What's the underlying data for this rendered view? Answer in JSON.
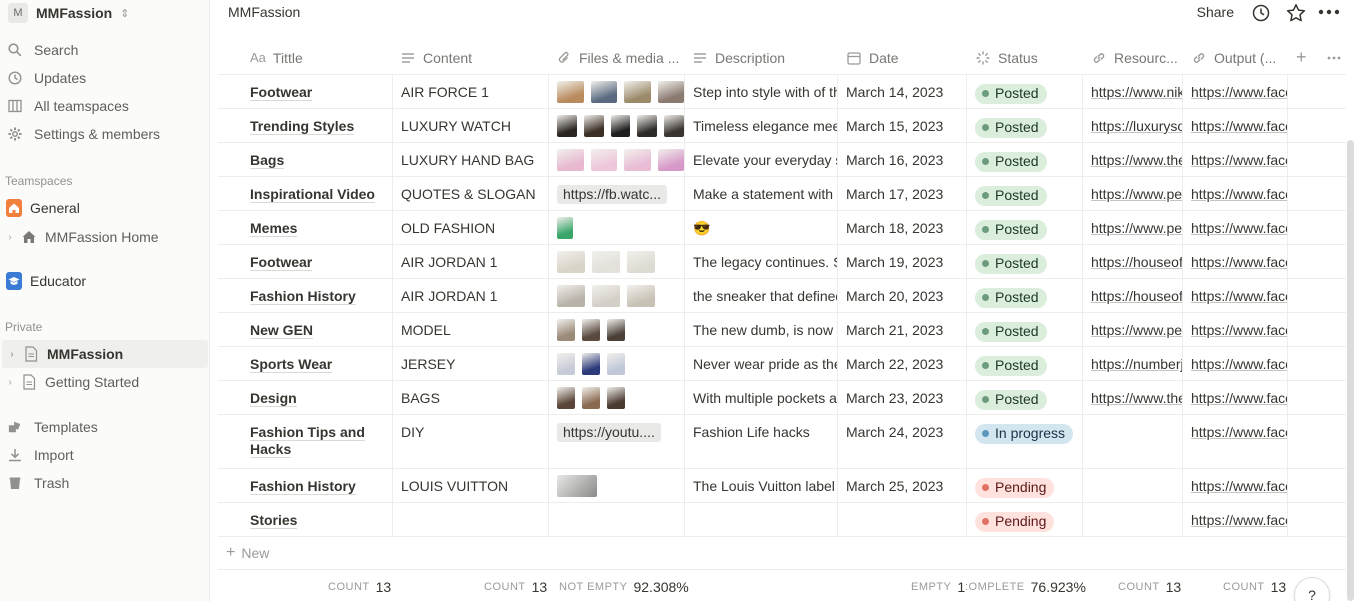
{
  "workspace": {
    "initial": "M",
    "name": "MMFassion"
  },
  "sidebar": {
    "nav": [
      {
        "label": "Search",
        "icon": "search-icon"
      },
      {
        "label": "Updates",
        "icon": "clock-icon"
      },
      {
        "label": "All teamspaces",
        "icon": "teamspaces-icon"
      },
      {
        "label": "Settings & members",
        "icon": "gear-icon"
      }
    ],
    "teamspaces_label": "Teamspaces",
    "teamspaces": [
      {
        "label": "General"
      },
      {
        "label": "MMFassion Home"
      },
      {
        "label": "Educator"
      }
    ],
    "private_label": "Private",
    "private": [
      {
        "label": "MMFassion"
      },
      {
        "label": "Getting Started"
      }
    ],
    "bottom": [
      {
        "label": "Templates",
        "icon": "templates-icon"
      },
      {
        "label": "Import",
        "icon": "import-icon"
      },
      {
        "label": "Trash",
        "icon": "trash-icon"
      }
    ]
  },
  "topbar": {
    "breadcrumb": "MMFassion",
    "share": "Share"
  },
  "table": {
    "columns": [
      {
        "label": "Tittle",
        "icon": "Aa"
      },
      {
        "label": "Content"
      },
      {
        "label": "Files & media ..."
      },
      {
        "label": "Description"
      },
      {
        "label": "Date"
      },
      {
        "label": "Status"
      },
      {
        "label": "Resourc..."
      },
      {
        "label": "Output (..."
      }
    ],
    "rows": [
      {
        "title": "Footwear",
        "content": "AIR FORCE 1",
        "files": [
          "#b98a5c",
          "#5a6a80",
          "#9a8a6a",
          "#8a7a70"
        ],
        "desc": "Step into style with of the",
        "date": "March 14, 2023",
        "status": "Posted",
        "resource": "https://www.nike.com",
        "output": "https://www.facebook.com"
      },
      {
        "title": "Trending Styles",
        "content": "LUXURY WATCH",
        "files": [
          "#2a2520",
          "#3a2e25",
          "#1f1f1f",
          "#2e2a28",
          "#3a3530"
        ],
        "desc": "Timeless elegance meets",
        "date": "March 15, 2023",
        "status": "Posted",
        "resource": "https://luxurysource.com",
        "output": "https://www.facebook.com"
      },
      {
        "title": "Bags",
        "content": "LUXURY HAND BAG",
        "files": [
          "#e7b8d0",
          "#eec6dc",
          "#e9bcd6",
          "#d79ac8"
        ],
        "desc": "Elevate your everyday style",
        "date": "March 16, 2023",
        "status": "Posted",
        "resource": "https://www.thebag.com",
        "output": "https://www.facebook.com"
      },
      {
        "title": "Inspirational Video",
        "content": "QUOTES & SLOGAN",
        "file_url": "https://fb.watc...",
        "desc": "Make a statement with",
        "date": "March 17, 2023",
        "status": "Posted",
        "resource": "https://www.pexels.com",
        "output": "https://www.facebook.com"
      },
      {
        "title": "Memes",
        "content": "OLD FASHION",
        "files": [
          "#3aa66a"
        ],
        "desc": "😎",
        "date": "March 18, 2023",
        "status": "Posted",
        "resource": "https://www.pexels.com",
        "output": "https://www.facebook.com"
      },
      {
        "title": "Footwear",
        "content": "AIR JORDAN 1",
        "files": [
          "#d8d4c8",
          "#e3e1da",
          "#dedbd2"
        ],
        "desc": "The legacy continues. Step",
        "date": "March 19, 2023",
        "status": "Posted",
        "resource": "https://houseofheat.co",
        "output": "https://www.facebook.com"
      },
      {
        "title": "Fashion History",
        "content": "AIR JORDAN 1",
        "files": [
          "#b8b2a8",
          "#d4d0c8",
          "#c8c2b6"
        ],
        "desc": "the sneaker that defined",
        "date": "March 20, 2023",
        "status": "Posted",
        "resource": "https://houseofheat.co",
        "output": "https://www.facebook.com"
      },
      {
        "title": "New GEN",
        "content": "MODEL",
        "files": [
          "#9a8a78",
          "#5a4a40",
          "#4a4038"
        ],
        "desc": "The new dumb, is now the",
        "date": "March 21, 2023",
        "status": "Posted",
        "resource": "https://www.pexels.com",
        "output": "https://www.facebook.com"
      },
      {
        "title": "Sports Wear",
        "content": "JERSEY",
        "files": [
          "#c8ccd8",
          "#2a3a7a",
          "#c0c8d8"
        ],
        "desc": "Never wear pride as the",
        "date": "March 22, 2023",
        "status": "Posted",
        "resource": "https://numberjersey.com",
        "output": "https://www.facebook.com"
      },
      {
        "title": "Design",
        "content": "BAGS",
        "files": [
          "#5a4538",
          "#8a6a50",
          "#4a3a30"
        ],
        "desc": "With multiple pockets and",
        "date": "March 23, 2023",
        "status": "Posted",
        "resource": "https://www.thebag.com",
        "output": "https://www.facebook.com"
      },
      {
        "title": "Fashion Tips and Hacks",
        "content": "DIY",
        "file_url": "https://youtu....",
        "desc": "Fashion Life hacks",
        "date": "March 24, 2023",
        "status": "In progress",
        "resource": "",
        "output": "https://www.facebook.com"
      },
      {
        "title": "Fashion History",
        "content": "LOUIS VUITTON",
        "files_wide": "#8a8a88",
        "desc": "The Louis Vuitton label",
        "date": "March 25, 2023",
        "status": "Pending",
        "resource": "",
        "output": "https://www.facebook.com"
      },
      {
        "title": "Stories",
        "content": "",
        "desc": "",
        "date": "",
        "status": "Pending",
        "resource": "",
        "output": "https://www.facebook.com"
      }
    ],
    "new_label": "New"
  },
  "footer": {
    "title_count_label": "COUNT",
    "title_count": "13",
    "content_count_label": "COUNT",
    "content_count": "13",
    "files_label": "NOT EMPTY",
    "files_value": "92.308%",
    "date_label": "EMPTY",
    "date_value": "1",
    "status_label": ":OMPLETE",
    "status_value": "76.923%",
    "res_label": "COUNT",
    "res_value": "13",
    "out_label": "COUNT",
    "out_value": "13"
  },
  "help": "?"
}
